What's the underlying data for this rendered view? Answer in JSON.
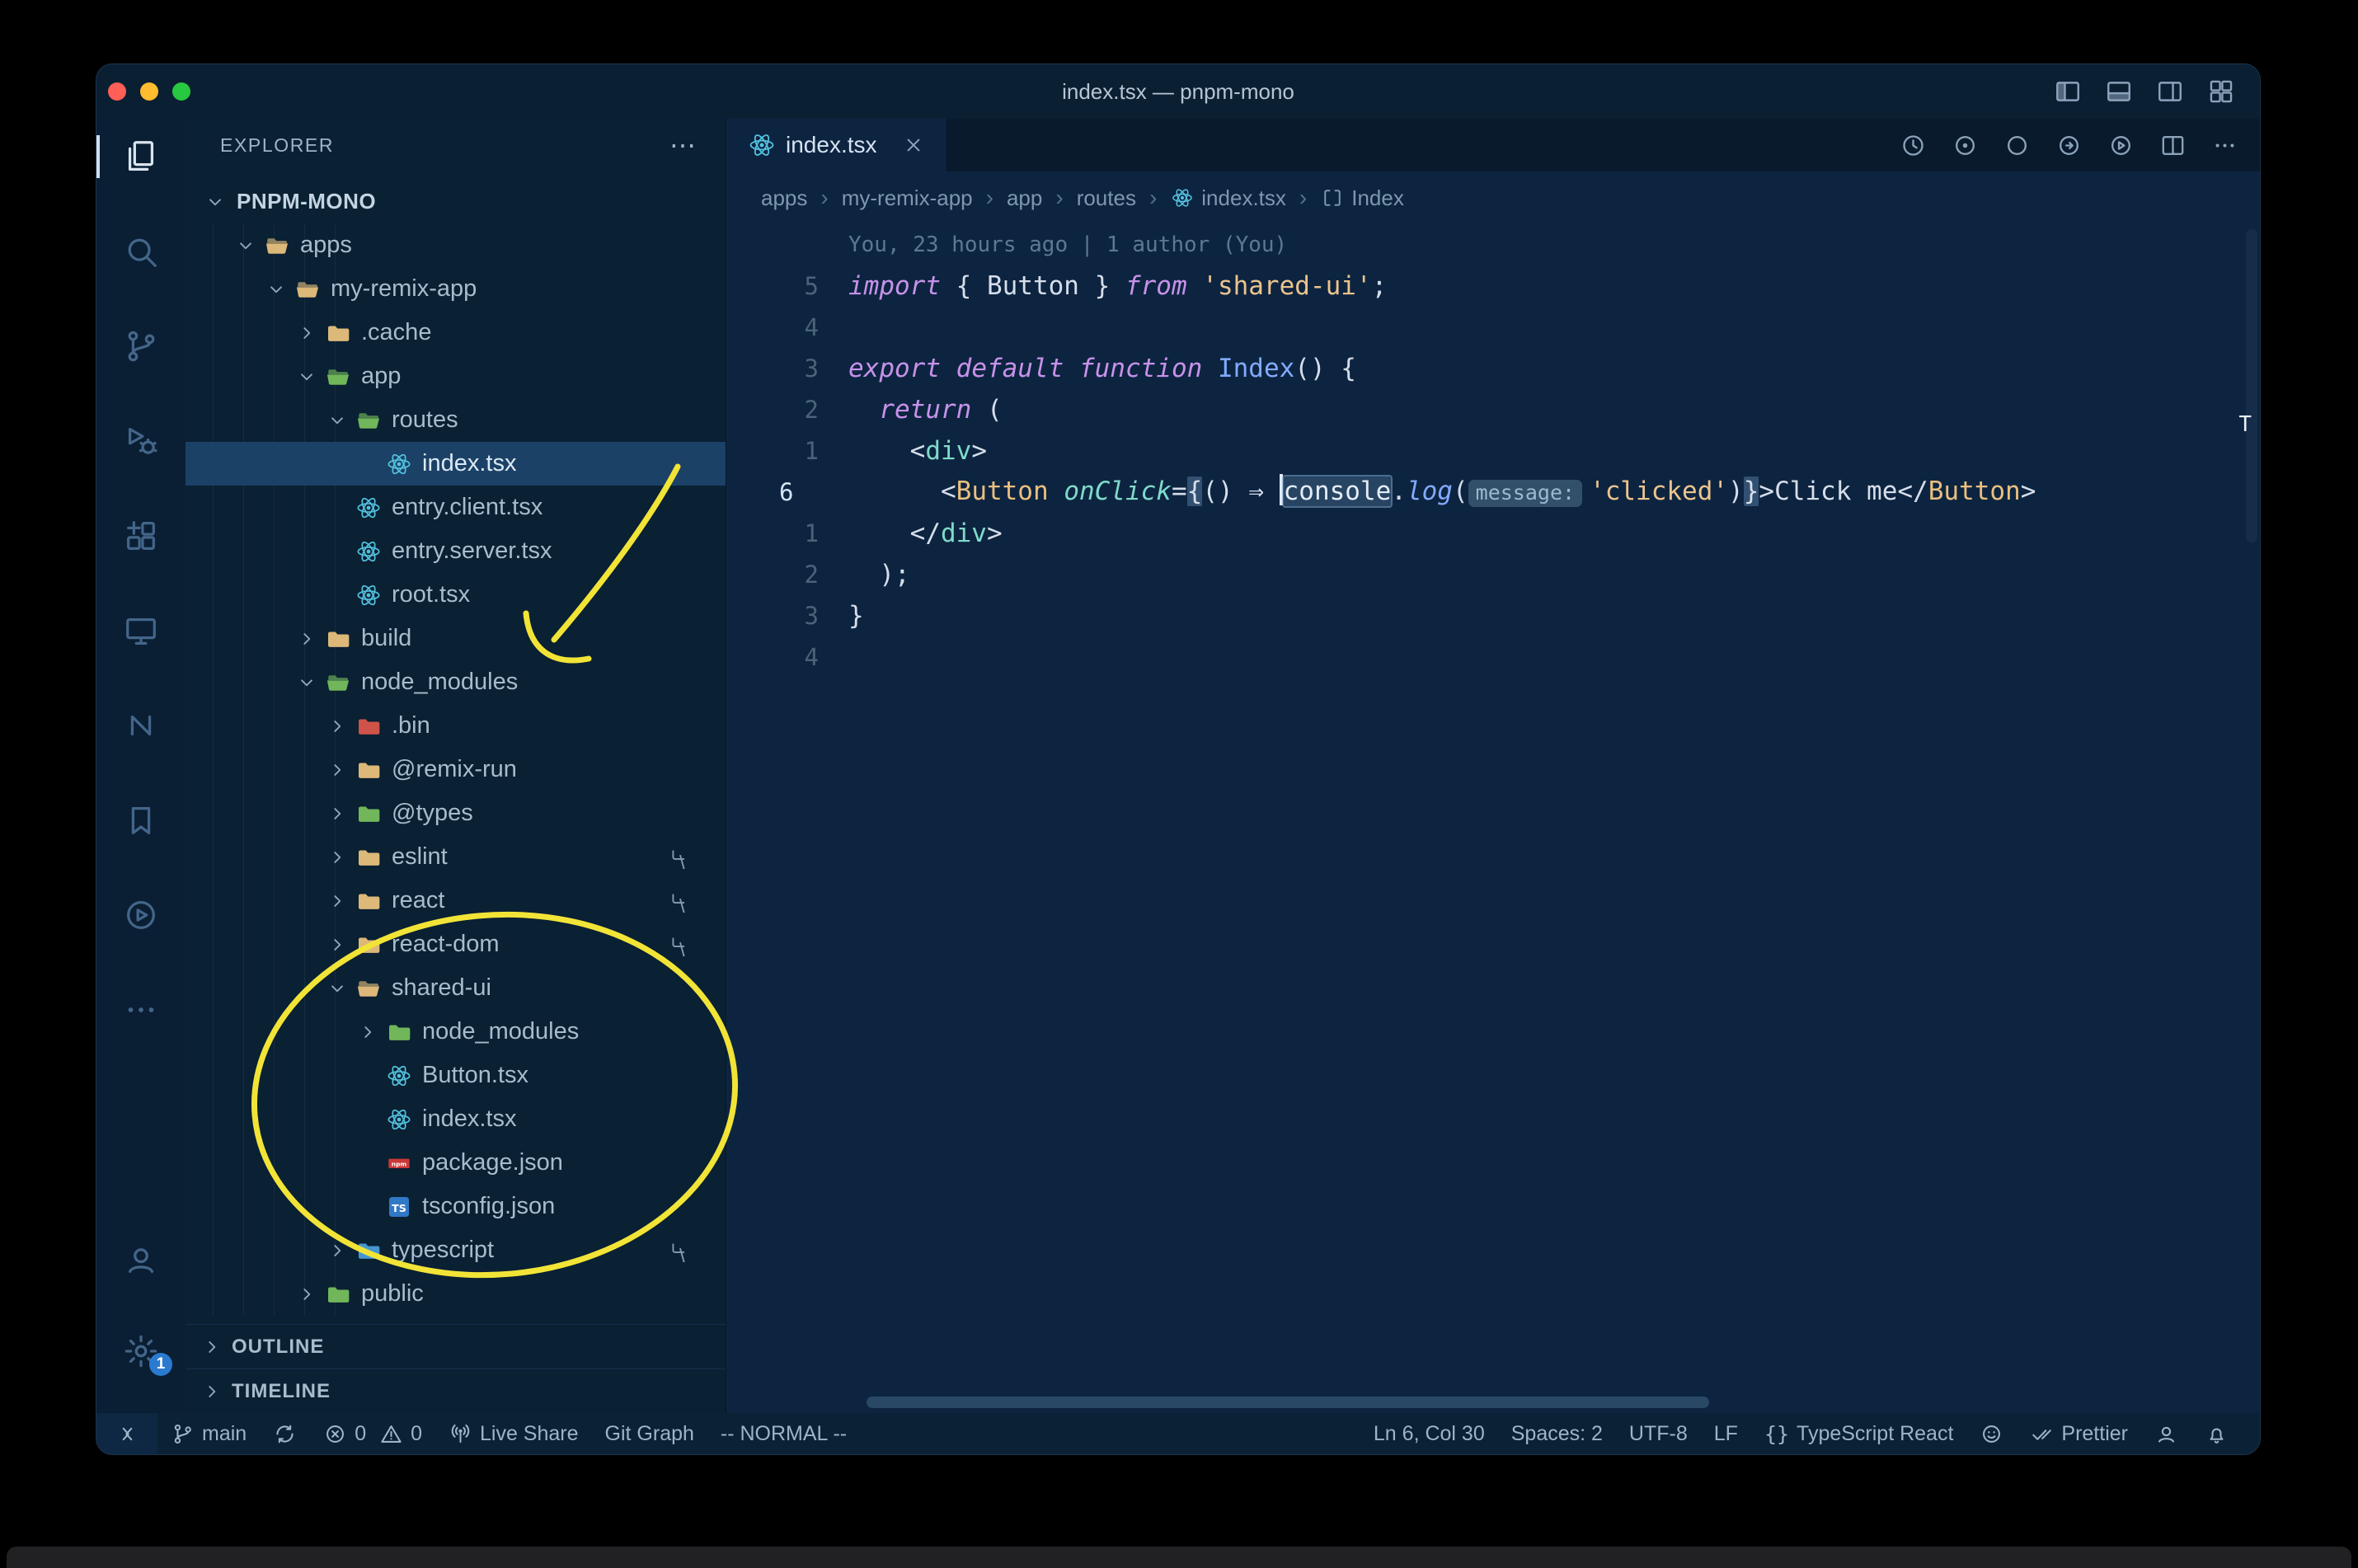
{
  "window": {
    "title": "index.tsx — pnpm-mono"
  },
  "colors": {
    "annotation_yellow": "#f2e437",
    "react_cyan": "#53c1de",
    "folder_tan": "#dcb879",
    "folder_green": "#71b65a",
    "folder_blue": "#4596d1",
    "folder_red": "#cf5349",
    "ts_blue": "#3178c6",
    "npm_red": "#cb3837"
  },
  "titlebar": {
    "controls": [
      {
        "name": "toggle-primary-sidebar",
        "icon": "panel-left"
      },
      {
        "name": "toggle-panel",
        "icon": "panel-bottom"
      },
      {
        "name": "toggle-secondary-sidebar",
        "icon": "panel-right"
      },
      {
        "name": "customize-layout",
        "icon": "layout-grid"
      }
    ]
  },
  "activity_bar": {
    "top": [
      {
        "name": "explorer",
        "icon": "files",
        "active": true
      },
      {
        "name": "search",
        "icon": "search"
      },
      {
        "name": "source-control",
        "icon": "branch"
      },
      {
        "name": "run-debug",
        "icon": "debug"
      },
      {
        "name": "extensions",
        "icon": "extensions"
      },
      {
        "name": "remote-explorer",
        "icon": "monitor"
      },
      {
        "name": "nx-console",
        "icon": "nx"
      },
      {
        "name": "bookmarks",
        "icon": "bookmark"
      },
      {
        "name": "live-share",
        "icon": "play-circle"
      },
      {
        "name": "more-views",
        "icon": "ellipsis"
      }
    ],
    "bottom": [
      {
        "name": "accounts",
        "icon": "account"
      },
      {
        "name": "settings",
        "icon": "gear",
        "badge": "1"
      }
    ]
  },
  "sidebar": {
    "header": "EXPLORER",
    "sections": [
      "OUTLINE",
      "TIMELINE"
    ],
    "tree": [
      {
        "label": "PNPM-MONO",
        "level": 0,
        "chev": "down",
        "bold": true
      },
      {
        "label": "apps",
        "level": 1,
        "chev": "down",
        "icon": "folder-open-tan"
      },
      {
        "label": "my-remix-app",
        "level": 2,
        "chev": "down",
        "icon": "folder-open-tan"
      },
      {
        "label": ".cache",
        "level": 3,
        "chev": "right",
        "icon": "folder-tan"
      },
      {
        "label": "app",
        "level": 3,
        "chev": "down",
        "icon": "folder-open-green"
      },
      {
        "label": "routes",
        "level": 4,
        "chev": "down",
        "icon": "folder-open-green"
      },
      {
        "label": "index.tsx",
        "level": 5,
        "icon": "react",
        "selected": true
      },
      {
        "label": "entry.client.tsx",
        "level": 4,
        "icon": "react"
      },
      {
        "label": "entry.server.tsx",
        "level": 4,
        "icon": "react"
      },
      {
        "label": "root.tsx",
        "level": 4,
        "icon": "react"
      },
      {
        "label": "build",
        "level": 3,
        "chev": "right",
        "icon": "folder-tan"
      },
      {
        "label": "node_modules",
        "level": 3,
        "chev": "down",
        "icon": "folder-open-green"
      },
      {
        "label": ".bin",
        "level": 4,
        "chev": "right",
        "icon": "folder-red"
      },
      {
        "label": "@remix-run",
        "level": 4,
        "chev": "right",
        "icon": "folder-tan"
      },
      {
        "label": "@types",
        "level": 4,
        "chev": "right",
        "icon": "folder-green"
      },
      {
        "label": "eslint",
        "level": 4,
        "chev": "right",
        "icon": "folder-tan",
        "symlink": true
      },
      {
        "label": "react",
        "level": 4,
        "chev": "right",
        "icon": "folder-tan",
        "symlink": true
      },
      {
        "label": "react-dom",
        "level": 4,
        "chev": "right",
        "icon": "folder-tan",
        "symlink": true
      },
      {
        "label": "shared-ui",
        "level": 4,
        "chev": "down",
        "icon": "folder-open-tan"
      },
      {
        "label": "node_modules",
        "level": 5,
        "chev": "right",
        "icon": "folder-green"
      },
      {
        "label": "Button.tsx",
        "level": 5,
        "icon": "react"
      },
      {
        "label": "index.tsx",
        "level": 5,
        "icon": "react"
      },
      {
        "label": "package.json",
        "level": 5,
        "icon": "npm"
      },
      {
        "label": "tsconfig.json",
        "level": 5,
        "icon": "ts"
      },
      {
        "label": "typescript",
        "level": 4,
        "chev": "right",
        "icon": "folder-blue",
        "symlink": true
      },
      {
        "label": "public",
        "level": 3,
        "chev": "right",
        "icon": "folder-green"
      }
    ]
  },
  "editor": {
    "tab": {
      "label": "index.tsx"
    },
    "actions": [
      {
        "name": "local-history",
        "icon": "history"
      },
      {
        "name": "gitlens-annotate",
        "icon": "target"
      },
      {
        "name": "toggle-blame",
        "icon": "circle-o"
      },
      {
        "name": "open-changes",
        "icon": "circle-arrow"
      },
      {
        "name": "run-file",
        "icon": "run"
      },
      {
        "name": "split-editor",
        "icon": "split-editor"
      },
      {
        "name": "more-actions",
        "icon": "ellipsis"
      }
    ],
    "breadcrumbs": [
      {
        "label": "apps"
      },
      {
        "label": "my-remix-app"
      },
      {
        "label": "app"
      },
      {
        "label": "routes"
      },
      {
        "label": "index.tsx",
        "icon": "react"
      },
      {
        "label": "Index",
        "icon": "symbol-module"
      }
    ],
    "blame": "You, 23 hours ago | 1 author (You)",
    "overview_marker": "T",
    "code": {
      "lines": [
        {
          "gutter": "5",
          "tokens": [
            [
              "import",
              "kw"
            ],
            [
              " { Button } ",
              "pt"
            ],
            [
              "from",
              "kw"
            ],
            [
              " ",
              "pt"
            ],
            [
              "'shared-ui'",
              "str"
            ],
            [
              ";",
              "pt"
            ]
          ]
        },
        {
          "gutter": "4",
          "tokens": []
        },
        {
          "gutter": "3",
          "tokens": [
            [
              "export",
              "kw"
            ],
            [
              " ",
              "pt"
            ],
            [
              "default",
              "kw"
            ],
            [
              " ",
              "pt"
            ],
            [
              "function",
              "kw"
            ],
            [
              " ",
              "pt"
            ],
            [
              "Index",
              "fn"
            ],
            [
              "() {",
              "pt"
            ]
          ]
        },
        {
          "gutter": "2",
          "tokens": [
            [
              "  ",
              "pt"
            ],
            [
              "return",
              "kw"
            ],
            [
              " (",
              "pt"
            ]
          ]
        },
        {
          "gutter": "1",
          "tokens": [
            [
              "    <",
              "pt"
            ],
            [
              "div",
              "tag"
            ],
            [
              ">",
              "pt"
            ]
          ]
        },
        {
          "gutter": "6",
          "current": true,
          "tokens": [
            [
              "      <",
              "pt"
            ],
            [
              "Button",
              "cmp"
            ],
            [
              " ",
              "pt"
            ],
            [
              "onClick",
              "attr"
            ],
            [
              "=",
              "pt"
            ],
            [
              "{",
              "bkt"
            ],
            [
              "() ",
              "pt"
            ],
            [
              "⇒ ",
              "pt"
            ],
            [
              "",
              "caret"
            ],
            [
              "console",
              "whl"
            ],
            [
              ".",
              "pt"
            ],
            [
              "log",
              "fnit"
            ],
            [
              "(",
              "pt"
            ],
            [
              "message:",
              "inlay"
            ],
            [
              "'clicked'",
              "str"
            ],
            [
              ")",
              "pt"
            ],
            [
              "}",
              "bkt"
            ],
            [
              ">",
              "pt"
            ],
            [
              "Click me",
              "pt"
            ],
            [
              "</",
              "pt"
            ],
            [
              "Button",
              "cmp"
            ],
            [
              ">",
              "pt"
            ]
          ]
        },
        {
          "gutter": "1",
          "tokens": [
            [
              "    </",
              "pt"
            ],
            [
              "div",
              "tag"
            ],
            [
              ">",
              "pt"
            ]
          ]
        },
        {
          "gutter": "2",
          "tokens": [
            [
              "  );",
              "pt"
            ]
          ]
        },
        {
          "gutter": "3",
          "tokens": [
            [
              "}",
              "pt"
            ]
          ]
        },
        {
          "gutter": "4",
          "tokens": []
        }
      ]
    }
  },
  "status_bar": {
    "left": [
      {
        "name": "remote-indicator",
        "icon": "remote",
        "tile": true
      },
      {
        "name": "git-branch",
        "icon": "branch",
        "label": "main"
      },
      {
        "name": "sync",
        "icon": "sync"
      },
      {
        "name": "errors",
        "icon": "error",
        "label": "0"
      },
      {
        "name": "warnings",
        "icon": "warning",
        "label": "0",
        "tight": true
      },
      {
        "name": "live-share",
        "icon": "broadcast",
        "label": "Live Share"
      },
      {
        "name": "git-graph",
        "label": "Git Graph"
      },
      {
        "name": "vim-mode",
        "label": "-- NORMAL --"
      }
    ],
    "right": [
      {
        "name": "cursor-position",
        "label": "Ln 6, Col 30"
      },
      {
        "name": "indentation",
        "label": "Spaces: 2"
      },
      {
        "name": "encoding",
        "label": "UTF-8"
      },
      {
        "name": "eol",
        "label": "LF"
      },
      {
        "name": "language-mode",
        "icon": "braces",
        "label": "TypeScript React"
      },
      {
        "name": "tweet-feedback",
        "icon": "smiley"
      },
      {
        "name": "prettier",
        "icon": "check-double",
        "label": "Prettier"
      },
      {
        "name": "remote-feedback",
        "icon": "person"
      },
      {
        "name": "notifications",
        "icon": "bell"
      }
    ]
  }
}
